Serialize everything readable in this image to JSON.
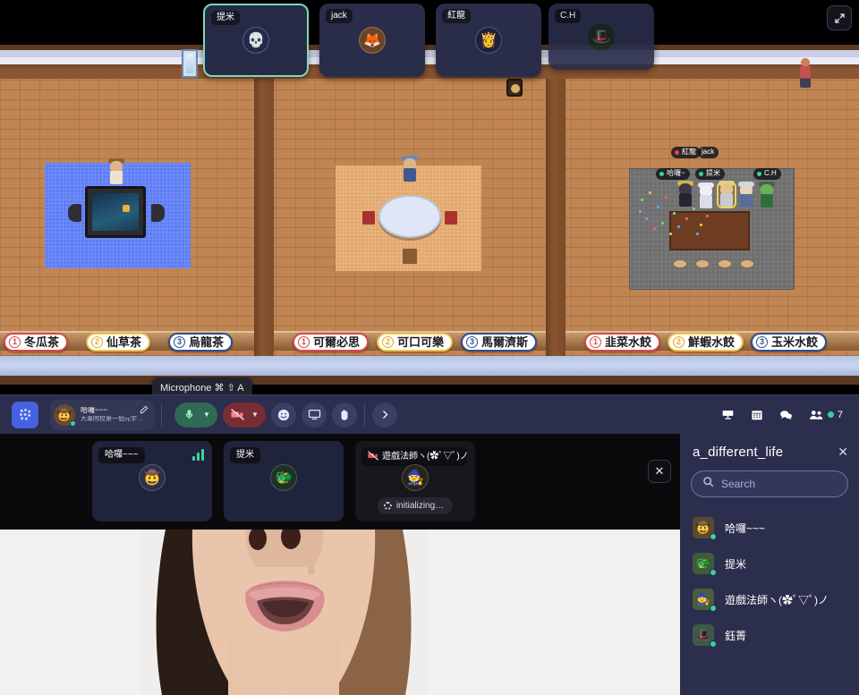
{
  "window": {
    "title": "a_different_life"
  },
  "top_cards": {
    "expand_icon": "expand-icon",
    "items": [
      {
        "name": "提米",
        "avatar": "skull",
        "active": true
      },
      {
        "name": "jack",
        "avatar": "fox",
        "active": false
      },
      {
        "name": "紅龍",
        "avatar": "blonde",
        "active": false
      },
      {
        "name": "C.H",
        "avatar": "green-hat",
        "active": false
      }
    ]
  },
  "map": {
    "nametags": [
      {
        "label": "紅龍",
        "dot": "#e04a4a"
      },
      {
        "label": "jack",
        "dot": ""
      },
      {
        "label": "哈囉~",
        "dot": "#36d399"
      },
      {
        "label": "提米",
        "dot": "#36d399"
      },
      {
        "label": "C.H",
        "dot": "#36d399"
      }
    ],
    "counters": [
      {
        "num": "1",
        "label": "冬瓜茶",
        "color": "r"
      },
      {
        "num": "2",
        "label": "仙草茶",
        "color": "y"
      },
      {
        "num": "3",
        "label": "烏龍茶",
        "color": "b"
      },
      {
        "num": "1",
        "label": "可爾必思",
        "color": "r"
      },
      {
        "num": "2",
        "label": "可口可樂",
        "color": "y"
      },
      {
        "num": "3",
        "label": "馬爾濟斯",
        "color": "b"
      },
      {
        "num": "1",
        "label": "韭菜水餃",
        "color": "r"
      },
      {
        "num": "2",
        "label": "鮮蝦水餃",
        "color": "y"
      },
      {
        "num": "3",
        "label": "玉米水餃",
        "color": "b"
      }
    ]
  },
  "tooltip": {
    "text": "Microphone  ⌘ ⇧ A"
  },
  "toolbar": {
    "logo_icon": "gather-logo-icon",
    "user": {
      "name": "哈囉~~~",
      "status": "大專院校第一個元宇宙...",
      "edit_icon": "pencil-icon"
    },
    "mic_icon": "microphone-icon",
    "mic_caret": "chevron-down-icon",
    "camera_icon": "camera-off-icon",
    "camera_caret": "chevron-down-icon",
    "emoji_icon": "smiley-icon",
    "screenshare_icon": "monitor-icon",
    "raisehand_icon": "hand-icon",
    "more_icon": "chevron-right-icon",
    "right_icons": [
      {
        "name": "mainstage-icon"
      },
      {
        "name": "calendar-icon"
      },
      {
        "name": "chat-icon"
      }
    ],
    "participants_icon": "people-icon",
    "participants_count": "7"
  },
  "tiles": {
    "close_icon": "close-icon",
    "items": [
      {
        "name": "哈囉~~~",
        "avatar": "cowboy",
        "signal": true,
        "status": ""
      },
      {
        "name": "提米",
        "avatar": "green-knight",
        "signal": false,
        "status": ""
      },
      {
        "name": "遊戲法師ヽ(✿ﾟ▽ﾟ)ノ",
        "avatar": "wizard",
        "signal": false,
        "status": "initializing…",
        "muted_video": true
      }
    ]
  },
  "panel": {
    "title": "a_different_life",
    "close_icon": "close-icon",
    "search": {
      "placeholder": "Search",
      "icon": "search-icon",
      "value": ""
    },
    "participants": [
      {
        "name": "哈囉~~~",
        "avatar": "cowboy",
        "online": true
      },
      {
        "name": "提米",
        "avatar": "green-knight",
        "online": true
      },
      {
        "name": "遊戲法師ヽ(✿ﾟ▽ﾟ)ノ",
        "avatar": "wizard",
        "online": true
      },
      {
        "name": "鈺菁",
        "avatar": "hat-girl",
        "online": true
      }
    ]
  },
  "colors": {
    "toolbar_bg": "#2b2e4d",
    "accent_blue": "#4662e0",
    "online_green": "#36d399",
    "mic_green": "#2f6a54",
    "cam_red": "#7a2c34",
    "active_card_border": "#7fd9b6"
  }
}
